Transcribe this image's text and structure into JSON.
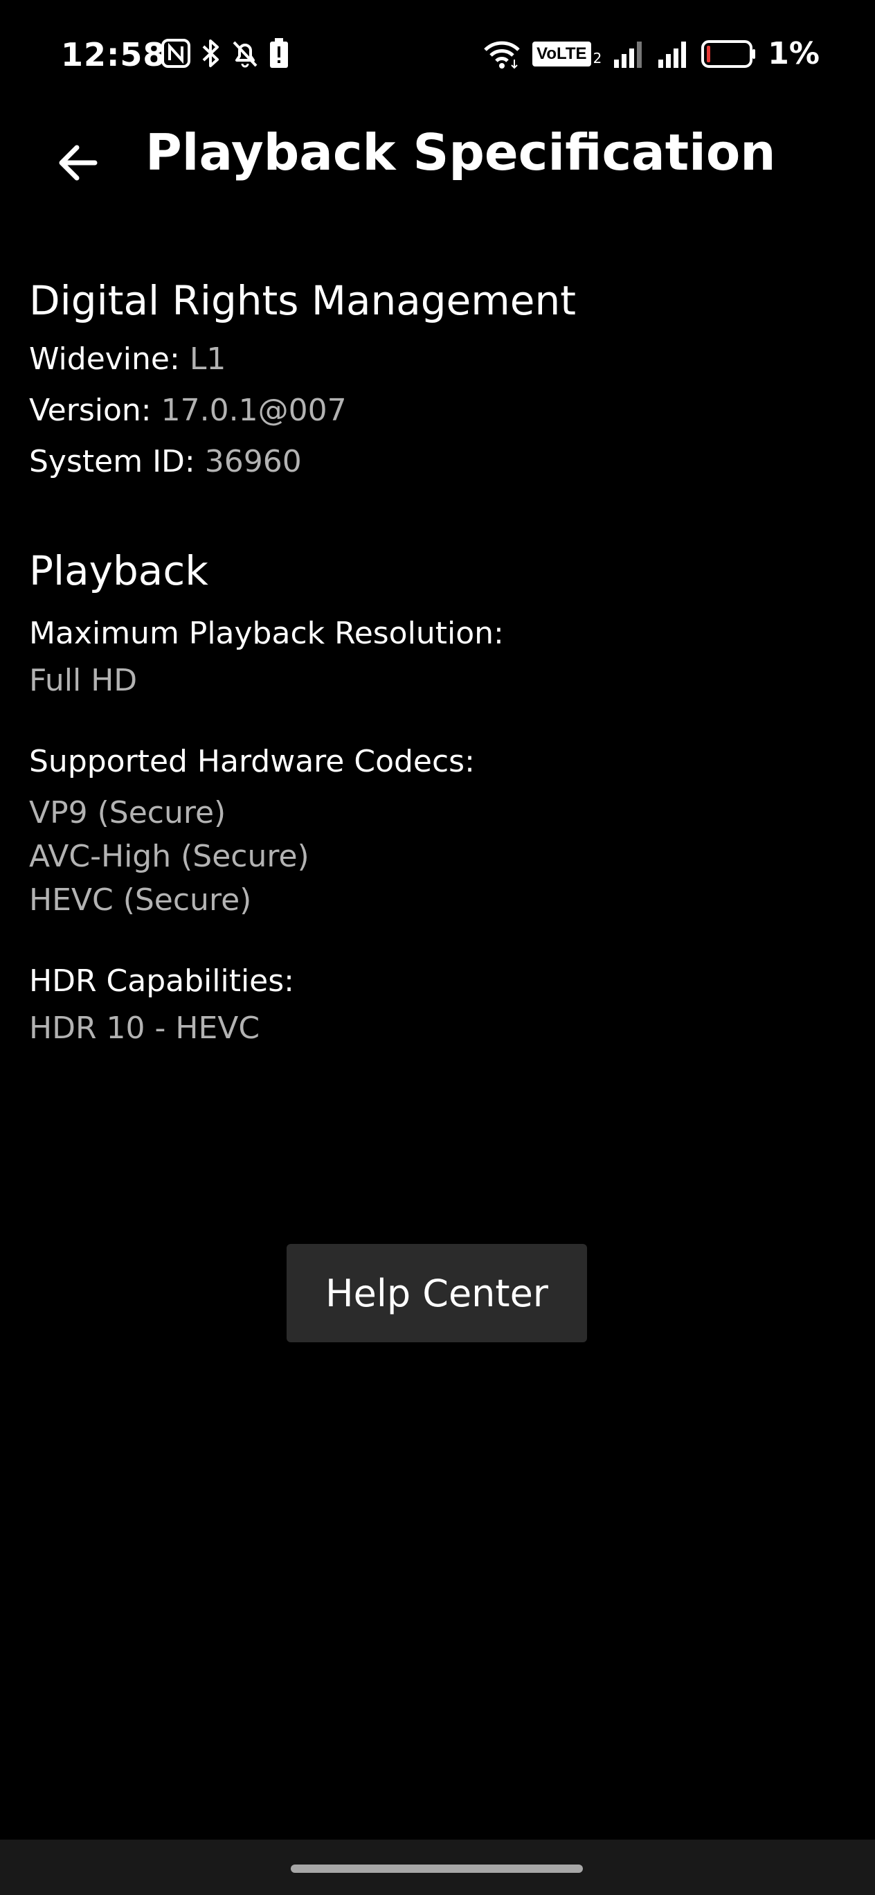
{
  "status_bar": {
    "time": "12:58",
    "battery_percent": "1%",
    "volte_label": "VoLTE",
    "left_icons": [
      "nfc-icon",
      "bluetooth-icon",
      "muted-bell-icon",
      "battery-alert-icon"
    ],
    "right_icons": [
      "wifi-icon",
      "volte-icon",
      "signal-icon",
      "signal-icon",
      "battery-icon"
    ]
  },
  "app_bar": {
    "title": "Playback Specification",
    "back_icon": "arrow-left-icon"
  },
  "drm": {
    "heading": "Digital Rights Management",
    "items": [
      {
        "label": "Widevine:",
        "value": "L1"
      },
      {
        "label": "Version:",
        "value": "17.0.1@007"
      },
      {
        "label": "System ID:",
        "value": "36960"
      }
    ]
  },
  "playback": {
    "heading": "Playback",
    "max_resolution": {
      "label": "Maximum Playback Resolution:",
      "value": "Full HD"
    },
    "codecs": {
      "label": "Supported Hardware Codecs:",
      "values": [
        "VP9 (Secure)",
        "AVC-High (Secure)",
        "HEVC (Secure)"
      ]
    },
    "hdr": {
      "label": "HDR Capabilities:",
      "value": "HDR 10 - HEVC"
    }
  },
  "help_button": {
    "label": "Help Center"
  },
  "colors": {
    "background": "#000000",
    "primary_text": "#ffffff",
    "secondary_text": "#b3b3b3",
    "button_bg": "#2b2b2b",
    "nav_bar_bg": "#191919",
    "battery_low": "#e53935"
  }
}
